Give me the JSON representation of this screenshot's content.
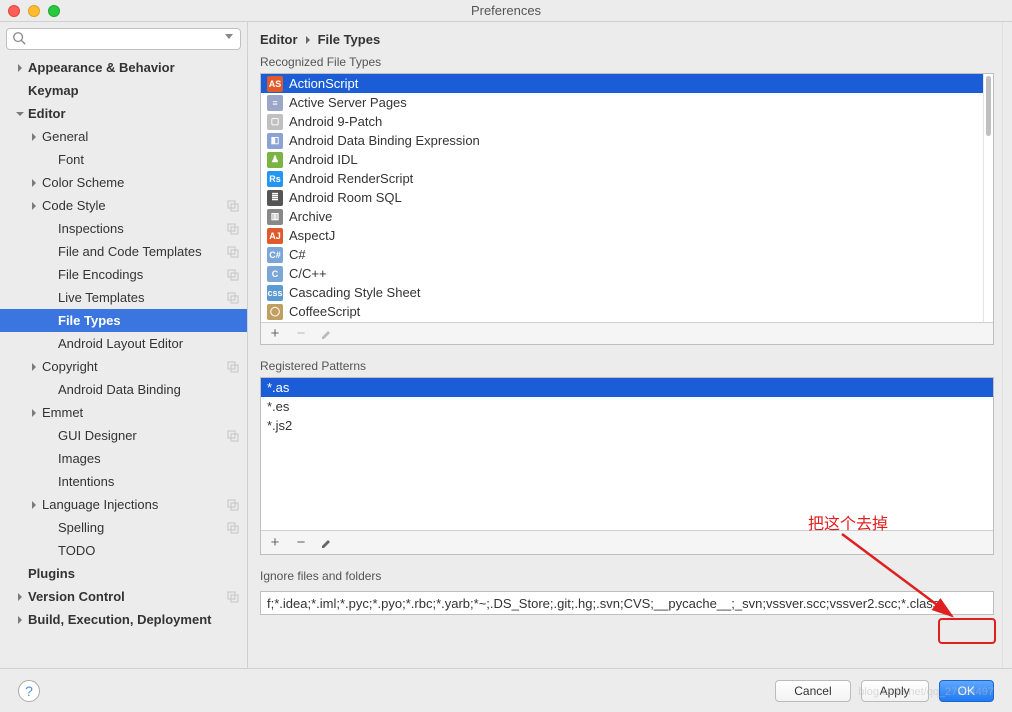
{
  "window": {
    "title": "Preferences"
  },
  "search": {
    "placeholder": ""
  },
  "sidebar": {
    "items": [
      {
        "label": "Appearance & Behavior",
        "level": 0,
        "arrow": "right",
        "pg": false
      },
      {
        "label": "Keymap",
        "level": 0,
        "arrow": "",
        "pg": false
      },
      {
        "label": "Editor",
        "level": 0,
        "arrow": "down",
        "pg": false
      },
      {
        "label": "General",
        "level": 1,
        "arrow": "right",
        "pg": false
      },
      {
        "label": "Font",
        "level": 2,
        "arrow": "",
        "pg": false
      },
      {
        "label": "Color Scheme",
        "level": 1,
        "arrow": "right",
        "pg": false
      },
      {
        "label": "Code Style",
        "level": 1,
        "arrow": "right",
        "pg": true
      },
      {
        "label": "Inspections",
        "level": 2,
        "arrow": "",
        "pg": true
      },
      {
        "label": "File and Code Templates",
        "level": 2,
        "arrow": "",
        "pg": true
      },
      {
        "label": "File Encodings",
        "level": 2,
        "arrow": "",
        "pg": true
      },
      {
        "label": "Live Templates",
        "level": 2,
        "arrow": "",
        "pg": true
      },
      {
        "label": "File Types",
        "level": 2,
        "arrow": "",
        "pg": false,
        "selected": true
      },
      {
        "label": "Android Layout Editor",
        "level": 2,
        "arrow": "",
        "pg": false
      },
      {
        "label": "Copyright",
        "level": 1,
        "arrow": "right",
        "pg": true
      },
      {
        "label": "Android Data Binding",
        "level": 2,
        "arrow": "",
        "pg": false
      },
      {
        "label": "Emmet",
        "level": 1,
        "arrow": "right",
        "pg": false
      },
      {
        "label": "GUI Designer",
        "level": 2,
        "arrow": "",
        "pg": true
      },
      {
        "label": "Images",
        "level": 2,
        "arrow": "",
        "pg": false
      },
      {
        "label": "Intentions",
        "level": 2,
        "arrow": "",
        "pg": false
      },
      {
        "label": "Language Injections",
        "level": 1,
        "arrow": "right",
        "pg": true
      },
      {
        "label": "Spelling",
        "level": 2,
        "arrow": "",
        "pg": true
      },
      {
        "label": "TODO",
        "level": 2,
        "arrow": "",
        "pg": false
      },
      {
        "label": "Plugins",
        "level": 0,
        "arrow": "",
        "pg": false
      },
      {
        "label": "Version Control",
        "level": 0,
        "arrow": "right",
        "pg": true
      },
      {
        "label": "Build, Execution, Deployment",
        "level": 0,
        "arrow": "right",
        "pg": false
      }
    ]
  },
  "breadcrumb": {
    "p0": "Editor",
    "p1": "File Types"
  },
  "recognized": {
    "label": "Recognized File Types",
    "items": [
      {
        "label": "ActionScript",
        "ico": "AS",
        "bg": "#e05a2b",
        "selected": true
      },
      {
        "label": "Active Server Pages",
        "ico": "≡",
        "bg": "#9aa7c8"
      },
      {
        "label": "Android 9-Patch",
        "ico": "▢",
        "bg": "#c0c0c0"
      },
      {
        "label": "Android Data Binding Expression",
        "ico": "◧",
        "bg": "#8aa3d4"
      },
      {
        "label": "Android IDL",
        "ico": "♟",
        "bg": "#7cb342"
      },
      {
        "label": "Android RenderScript",
        "ico": "Rs",
        "bg": "#2196f3"
      },
      {
        "label": "Android Room SQL",
        "ico": "≣",
        "bg": "#555"
      },
      {
        "label": "Archive",
        "ico": "▥",
        "bg": "#888"
      },
      {
        "label": "AspectJ",
        "ico": "AJ",
        "bg": "#e05a2b"
      },
      {
        "label": "C#",
        "ico": "C#",
        "bg": "#7aa7d8"
      },
      {
        "label": "C/C++",
        "ico": "C",
        "bg": "#7aa7d8"
      },
      {
        "label": "Cascading Style Sheet",
        "ico": "css",
        "bg": "#5a9ad5"
      },
      {
        "label": "CoffeeScript",
        "ico": "◯",
        "bg": "#c0a060"
      }
    ]
  },
  "patterns": {
    "label": "Registered Patterns",
    "items": [
      {
        "label": "*.as",
        "selected": true
      },
      {
        "label": "*.es"
      },
      {
        "label": "*.js2"
      }
    ]
  },
  "ignore": {
    "label": "Ignore files and folders",
    "value": "f;*.idea;*.iml;*.pyc;*.pyo;*.rbc;*.yarb;*~;.DS_Store;.git;.hg;.svn;CVS;__pycache__;_svn;vssver.scc;vssver2.scc;*.class;"
  },
  "buttons": {
    "cancel": "Cancel",
    "apply": "Apply",
    "ok": "OK"
  },
  "annotation": {
    "text": "把这个去掉"
  },
  "watermark": "blog.csdn.net/qq_27984497"
}
